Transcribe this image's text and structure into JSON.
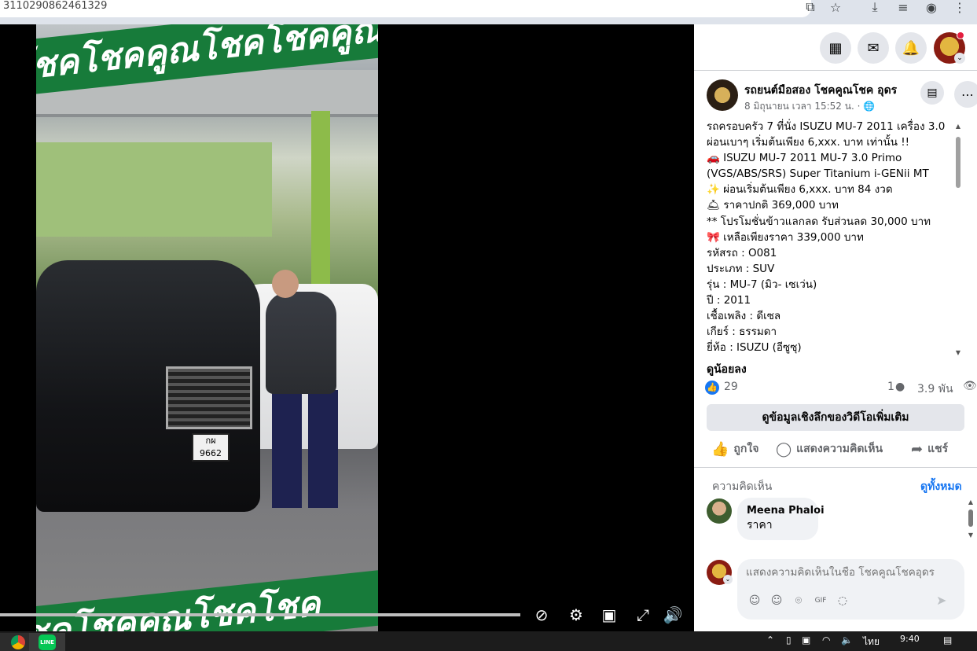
{
  "browser": {
    "url": "3110290862461329",
    "icons": [
      "install-icon",
      "star-icon",
      "download-icon",
      "media-icon",
      "profile-icon",
      "menu-icon"
    ]
  },
  "video": {
    "banner_text": "โชคโชคคูณโชคโชคคูณ",
    "banner_bottom_text": "โชคโชคคูณโชคโชค",
    "plate_text": "กผ 9662"
  },
  "topnav": {
    "icons": [
      "apps-grid-icon",
      "messenger-icon",
      "notifications-icon",
      "account-avatar"
    ]
  },
  "post": {
    "page_name": "รถยนต์มือสอง โชคคูณโชค อุดร",
    "time": "8 มิถุนายน เวลา 15:52 น. · 🌐",
    "lines": [
      "รถครอบครัว 7 ที่นั่ง ISUZU MU-7 2011 เครื่อง 3.0",
      "ผ่อนเบาๆ เริ่มต้นเพียง 6,xxx. บาท เท่านั้น !!",
      "🚗 ISUZU MU-7 2011 MU-7 3.0 Primo",
      "(VGS/ABS/SRS) Super Titanium i-GENii MT",
      "✨ ผ่อนเริ่มต้นเพียง 6,xxx. บาท 84 งวด",
      "🛎 ราคาปกติ 369,000 บาท",
      "** โปรโมชั่นข้าวแลกลด รับส่วนลด 30,000 บาท",
      "🎀 เหลือเพียงราคา 339,000 บาท",
      "รหัสรถ : O081",
      "ประเภท : SUV",
      "รุ่น : MU-7 (มิว- เซเว่น)",
      "ปี : 2011",
      "เชื้อเพลิง : ดีเซล",
      "เกียร์ : ธรรมดา",
      "ยี่ห้อ : ISUZU (อีซูซุ)"
    ],
    "see_less": "ดูน้อยลง",
    "likes": "29",
    "comments_count": "1",
    "views": "3.9 พัน",
    "insights_button": "ดูข้อมูลเชิงลึกของวิดีโอเพิ่มเติม",
    "actions": {
      "like": "ถูกใจ",
      "comment": "แสดงความคิดเห็น",
      "share": "แชร์"
    }
  },
  "comments": {
    "header": "ความคิดเห็น",
    "view_all": "ดูทั้งหมด",
    "items": [
      {
        "author": "Meena Phaloi",
        "text": "ราคา"
      }
    ],
    "input_placeholder": "แสดงความคิดเห็นในชื่อ โชคคูณโชคอุดร"
  },
  "taskbar": {
    "time": "9:40",
    "lang": "ไทย",
    "line_label": "LINE"
  }
}
